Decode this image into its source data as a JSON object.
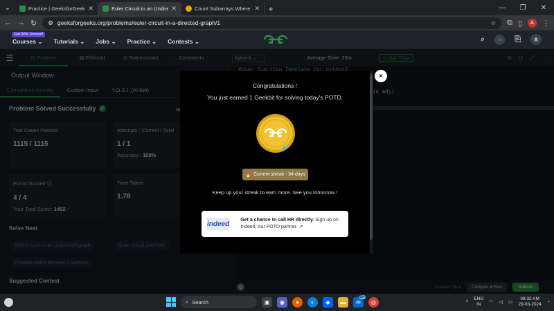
{
  "browser": {
    "tabs": [
      {
        "title": "Practice | GeeksforGeeks | A co",
        "active": false
      },
      {
        "title": "Euler Circuit in an Undirected G",
        "active": true
      },
      {
        "title": "Count Subarrays Where Max El",
        "active": false
      }
    ],
    "url": "geeksforgeeks.org/problems/euler-circuit-in-a-directed-graph/1",
    "profile_initial": "A"
  },
  "gfg_nav": {
    "refund_badge": "Get 90% Refund!",
    "items": [
      "Courses",
      "Tutorials",
      "Jobs",
      "Practice",
      "Contests"
    ],
    "avatar": "A"
  },
  "problem_tabs": [
    "Problem",
    "Editorial",
    "Submissions",
    "Comments"
  ],
  "left_panel": {
    "output_window": "Output Window",
    "result_tabs": [
      "Compilation Results",
      "Custom Input",
      "Y.O.G.I. (AI Bot)"
    ],
    "solved_text": "Problem Solved Successfully",
    "su_fragment": "Su",
    "test_cases_label": "Test Cases Passed",
    "test_cases_value": "1115 / 1115",
    "attempts_label": "Attempts : Correct / Total",
    "attempts_value": "1 / 1",
    "accuracy_label": "Accuracy :",
    "accuracy_value": "100%",
    "points_label": "Points Scored",
    "points_value": "4 / 4",
    "total_score_label": "Your Total Score:",
    "total_score_value": "1452",
    "time_label": "Time Taken",
    "time_value": "1.78",
    "solve_next": "Solve Next",
    "chips": [
      "Detect cycle in an undirected graph",
      "Euler circuit and Path",
      "Possible paths between 2 vertices"
    ],
    "suggested_contest": "Suggested Contest"
  },
  "editor": {
    "language": "Python3",
    "avg_time": "Average Time: 25m",
    "timer": "Start Timer",
    "line_numbers": [
      "1"
    ],
    "line1": "#User function Template for python3",
    "line_fragment": "in adj)",
    "custom_input": "Custom Input",
    "compile_run": "Compile & Run",
    "submit": "Submit"
  },
  "modal": {
    "title": "Congratulations !",
    "subtitle": "You just earned 1 Geekbit for solving today's POTD.",
    "streak": "Current streak : 34 days",
    "keep_up": "Keep up your streak to earn more. See you tomorrow !",
    "indeed_logo": "indeed",
    "indeed_bold": "Get a chance to call HR directly.",
    "indeed_rest": "Sign up on Indeed, our POTD partner.",
    "close": "×"
  },
  "taskbar": {
    "search": "Search",
    "lang_top": "ENG",
    "lang_bottom": "IN",
    "time": "08:32 AM",
    "date": "29-03-2024",
    "mail_badge": "99+"
  },
  "colors": {
    "gfg_green": "#2f8d46",
    "coin_gold": "#f2c230",
    "indeed_blue": "#2557a7"
  }
}
